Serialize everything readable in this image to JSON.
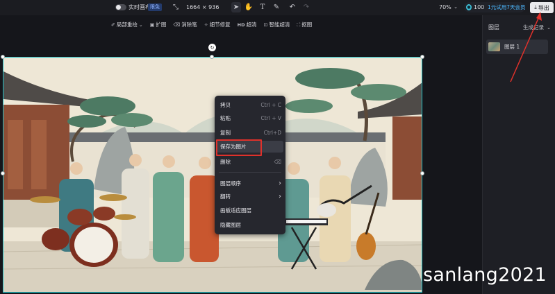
{
  "topbar": {
    "realtime_label": "实时画布",
    "realtime_badge": "限免",
    "canvas_size": "1664 × 936",
    "zoom": "70%",
    "credits": "100",
    "trial_text": "1元试用7天会员",
    "export_label": "导出"
  },
  "toolbar": {
    "items": [
      {
        "label": "局部重绘",
        "icon": "brush-icon",
        "dropdown": true
      },
      {
        "label": "扩图",
        "icon": "expand-icon"
      },
      {
        "label": "消除笔",
        "icon": "eraser-icon"
      },
      {
        "label": "细节修复",
        "icon": "wand-icon"
      },
      {
        "label": "超清",
        "icon": "hd-icon",
        "prefix": "HD"
      },
      {
        "label": "智能超清",
        "icon": "smart-hd-icon"
      },
      {
        "label": "抠图",
        "icon": "cutout-icon"
      }
    ]
  },
  "context_menu": {
    "items": [
      {
        "label": "拷贝",
        "shortcut": "Ctrl + C"
      },
      {
        "label": "粘贴",
        "shortcut": "Ctrl + V"
      },
      {
        "label": "复制",
        "shortcut": "Ctrl+D"
      },
      {
        "label": "保存为图片",
        "shortcut": ""
      },
      {
        "label": "删除",
        "shortcut": "⌫"
      },
      {
        "label": "图层顺序",
        "shortcut": "›"
      },
      {
        "label": "翻转",
        "shortcut": "›"
      },
      {
        "label": "画板适应图层",
        "shortcut": ""
      },
      {
        "label": "隐藏图层",
        "shortcut": ""
      }
    ]
  },
  "panel": {
    "title": "图层",
    "history_label": "生成记录",
    "layer_name": "图层 1"
  },
  "watermark": "sanlang2021",
  "colors": {
    "selection": "#22c3c8",
    "highlight": "#e0312b",
    "badge": "#8fb2ff"
  }
}
